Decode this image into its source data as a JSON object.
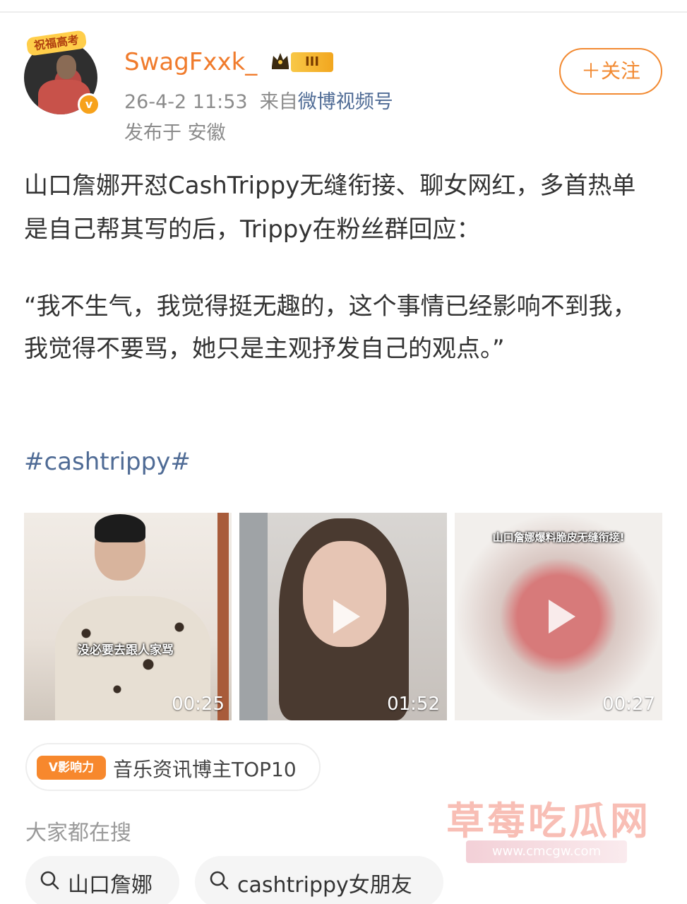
{
  "header": {
    "avatar_tag": "祝福高考",
    "verified_mark": "v",
    "username": "SwagFxxk_",
    "level_badge": "III",
    "timestamp": "26-4-2 11:53",
    "from_prefix": "来自",
    "source": "微博视频号",
    "location": "发布于 安徽",
    "follow_label": "＋关注"
  },
  "post": {
    "paragraph1": "山口詹娜开怼CashTrippy无缝衔接、聊女网红，多首热单是自己帮其写的后，Trippy在粉丝群回应：",
    "quote": "“我不生气，我觉得挺无趣的，这个事情已经影响不到我，我觉得不要骂，她只是主观抒发自己的观点。”",
    "hashtag": "#cashtrippy#"
  },
  "media": [
    {
      "caption": "没必要去跟人家骂",
      "duration": "00:25"
    },
    {
      "caption": "",
      "duration": "01:52"
    },
    {
      "caption": "山口詹娜爆料脆皮无缝衔接!",
      "duration": "00:27"
    }
  ],
  "influence": {
    "badge": "V影响力",
    "label": "音乐资讯博主TOP10"
  },
  "search": {
    "title": "大家都在搜",
    "chips": [
      "山口詹娜",
      "cashtrippy女朋友"
    ]
  },
  "watermark": {
    "title": "草莓吃瓜网",
    "url": "www.cmcgw.com"
  },
  "colors": {
    "username": "#f07b2c",
    "link": "#4f6b95",
    "follow": "#f28a32",
    "meta": "#8b8b8b"
  }
}
